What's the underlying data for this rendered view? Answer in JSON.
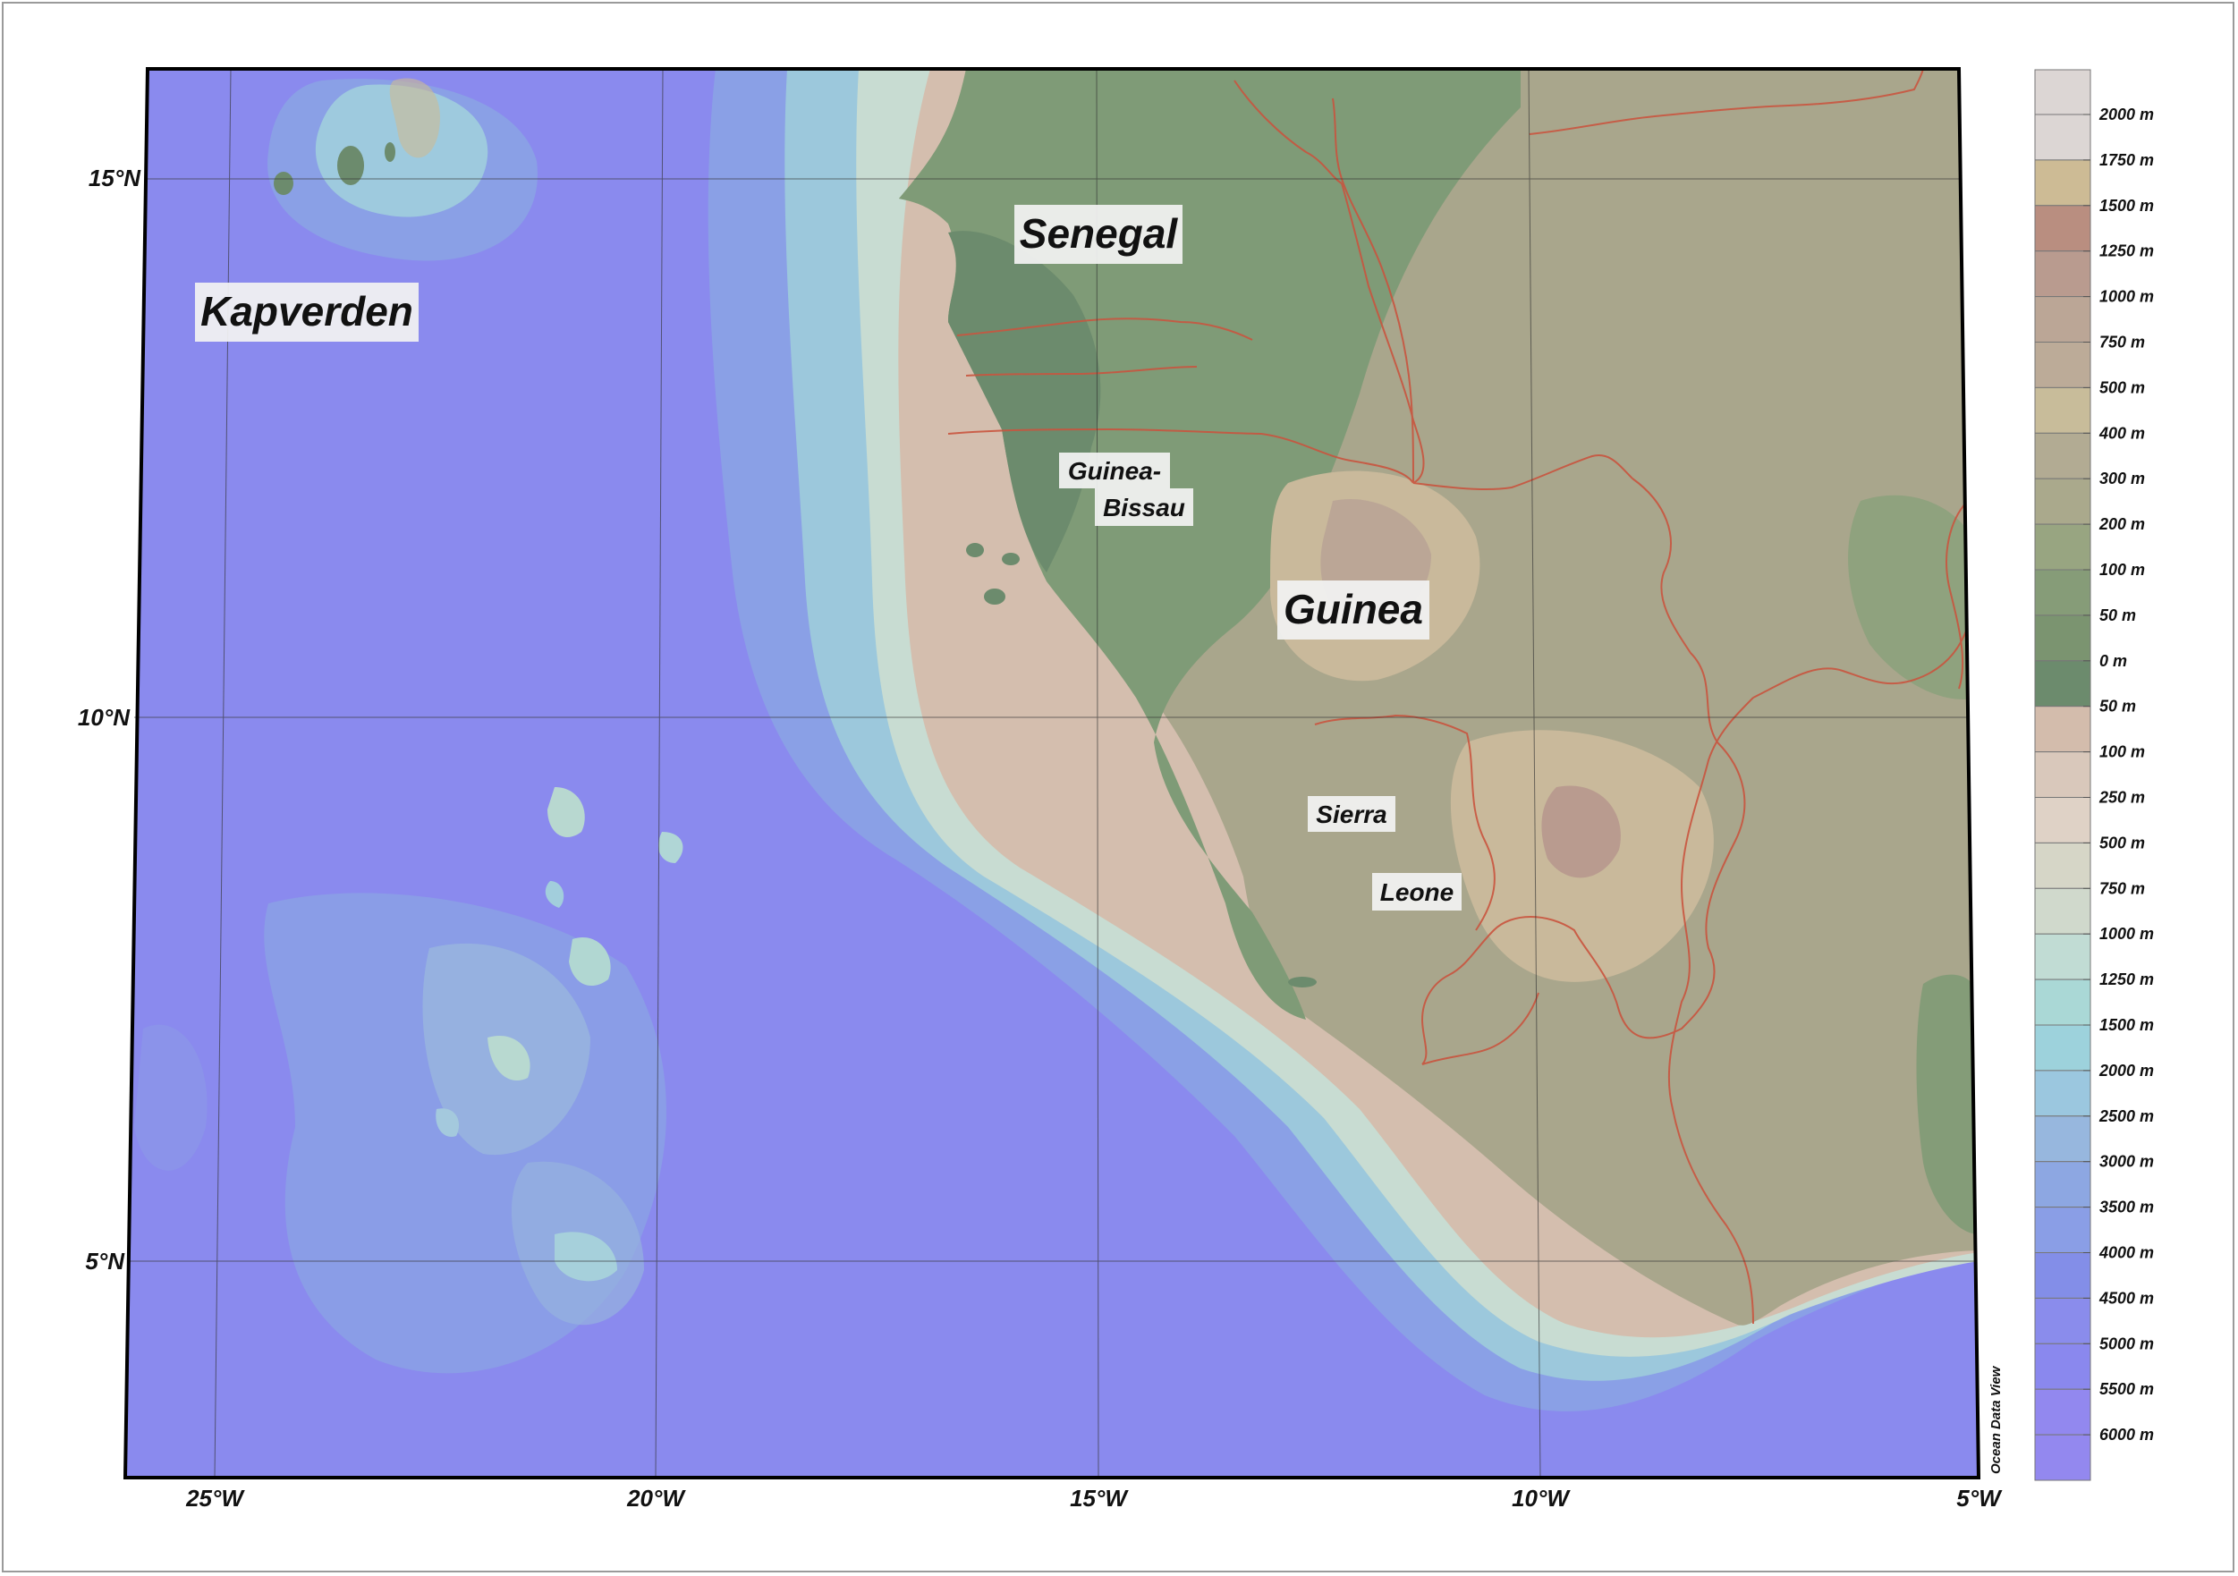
{
  "map": {
    "lat_labels": [
      "15°N",
      "10°N",
      "5°N"
    ],
    "lon_labels": [
      "25°W",
      "20°W",
      "15°W",
      "10°W",
      "5°W"
    ],
    "places": [
      {
        "id": "kapverden",
        "text": "Kapverden"
      },
      {
        "id": "senegal",
        "text": "Senegal"
      },
      {
        "id": "guinea-bissau-1",
        "text": "Guinea-"
      },
      {
        "id": "guinea-bissau-2",
        "text": "Bissau"
      },
      {
        "id": "guinea",
        "text": "Guinea"
      },
      {
        "id": "sierra",
        "text": "Sierra"
      },
      {
        "id": "leone",
        "text": "Leone"
      }
    ],
    "credit": "Ocean Data View"
  },
  "legend": {
    "labels": [
      "2000 m",
      "1750 m",
      "1500 m",
      "1250 m",
      "1000 m",
      "750 m",
      "500 m",
      "400 m",
      "300 m",
      "200 m",
      "100 m",
      "50 m",
      "0 m",
      "50 m",
      "100 m",
      "250 m",
      "500 m",
      "750 m",
      "1000 m",
      "1250 m",
      "1500 m",
      "2000 m",
      "2500 m",
      "3000 m",
      "3500 m",
      "4000 m",
      "4500 m",
      "5000 m",
      "5500 m",
      "6000 m"
    ],
    "colors": [
      "#dcd6d4",
      "#cdbb95",
      "#b98e80",
      "#b99b8f",
      "#bba696",
      "#bcab98",
      "#c8bc9a",
      "#b2ab93",
      "#aaa98c",
      "#98a581",
      "#869c78",
      "#7b9470",
      "#6c8b6d",
      "#d3bcac",
      "#d9c8bb",
      "#dfd2c6",
      "#d6d6c7",
      "#d0d9cc",
      "#c1dcd4",
      "#aad8d6",
      "#9dd2dc",
      "#9bc7df",
      "#97b7de",
      "#8da7e2",
      "#8a9ee6",
      "#838ee8",
      "#8a8cec",
      "#8a88ee",
      "#9288ef",
      "#9388ef"
    ]
  },
  "colors": {
    "ocean_deep": "#8a89ef",
    "ocean_mid": "#8aa0e6",
    "shelf": "#a6d6d8",
    "coastal_shallow": "#d4bfae",
    "lowland_green": "#7e9b76",
    "plateau": "#a8a68c",
    "highland": "#c9b99b",
    "border": "#c9553f"
  }
}
